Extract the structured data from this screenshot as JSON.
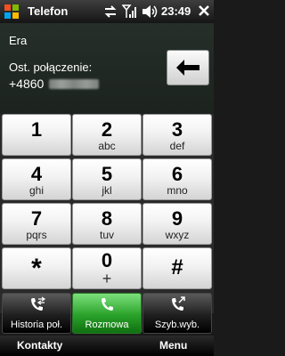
{
  "status": {
    "app_title": "Telefon",
    "time": "23:49",
    "icons": [
      "windows-logo-icon",
      "data-sync-icon",
      "signal-icon",
      "volume-icon",
      "close-icon"
    ]
  },
  "info": {
    "operator": "Era",
    "last_call_label": "Ost. połączenie:",
    "last_call_number": "+4860"
  },
  "keys": [
    {
      "digit": "1",
      "letters": ""
    },
    {
      "digit": "2",
      "letters": "abc"
    },
    {
      "digit": "3",
      "letters": "def"
    },
    {
      "digit": "4",
      "letters": "ghi"
    },
    {
      "digit": "5",
      "letters": "jkl"
    },
    {
      "digit": "6",
      "letters": "mno"
    },
    {
      "digit": "7",
      "letters": "pqrs"
    },
    {
      "digit": "8",
      "letters": "tuv"
    },
    {
      "digit": "9",
      "letters": "wxyz"
    },
    {
      "digit": "*",
      "letters": ""
    },
    {
      "digit": "0",
      "letters": "+"
    },
    {
      "digit": "#",
      "letters": ""
    }
  ],
  "actions": {
    "history": "Historia poł.",
    "call": "Rozmowa",
    "speed_dial": "Szyb.wyb."
  },
  "softkeys": {
    "left": "Kontakty",
    "right": "Menu"
  },
  "colors": {
    "call_green": "#2aa22a",
    "panel_bg": "#262f2a"
  }
}
